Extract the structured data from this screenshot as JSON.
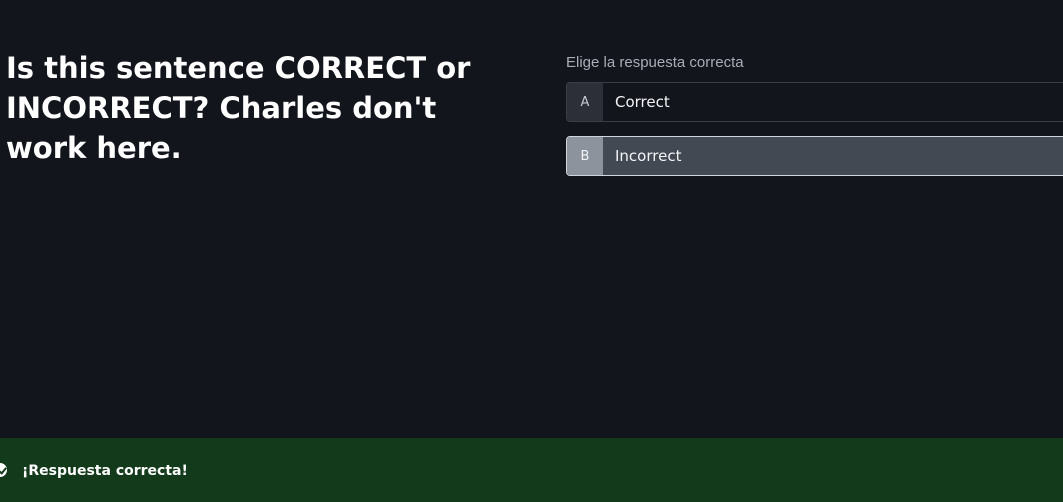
{
  "question": {
    "text": "Is this sentence CORRECT or INCORRECT? Charles don't work here."
  },
  "answers": {
    "prompt": "Elige la respuesta correcta",
    "options": [
      {
        "letter": "A",
        "label": "Correct",
        "selected": false
      },
      {
        "letter": "B",
        "label": "Incorrect",
        "selected": true
      }
    ]
  },
  "feedback": {
    "icon": "check-circle-icon",
    "message": "¡Respuesta correcta!",
    "color": "#133a1a"
  },
  "colors": {
    "background": "#13151d",
    "selected_option": "#434952"
  }
}
